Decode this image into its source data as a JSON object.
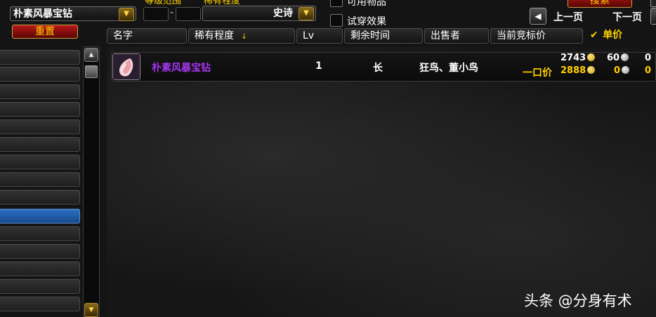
{
  "search": {
    "name_value": "朴素风暴宝钻",
    "reset_label": "重置",
    "level_range_label": "等级范围",
    "level_separator": "-",
    "rarity_label": "稀有程度",
    "rarity_value": "史诗",
    "usable_label": "可用物品",
    "preview_label": "试穿效果",
    "search_button_label": "搜索"
  },
  "pagination": {
    "prev_label": "上一页",
    "next_label": "下一页"
  },
  "columns": {
    "name": "名字",
    "rarity": "稀有程度",
    "level": "Lv",
    "time_left": "剩余时间",
    "seller": "出售者",
    "current_bid": "当前竞标价",
    "unit_price": "单价"
  },
  "items": [
    {
      "name": "朴素风暴宝钻",
      "name_color": "#a335ee",
      "level": "1",
      "time_left": "长",
      "seller": "狂鸟、董小鸟",
      "bid_gold": "2743",
      "bid_silver": "60",
      "bid_copper": "0",
      "buyout_label": "一口价",
      "buyout_gold": "2888",
      "buyout_silver": "0",
      "buyout_copper": "0"
    }
  ],
  "watermark": "头条 @分身有术",
  "colors": {
    "accent_gold": "#ffd100",
    "epic_purple": "#a335ee",
    "active_blue": "#2c6fc4"
  }
}
